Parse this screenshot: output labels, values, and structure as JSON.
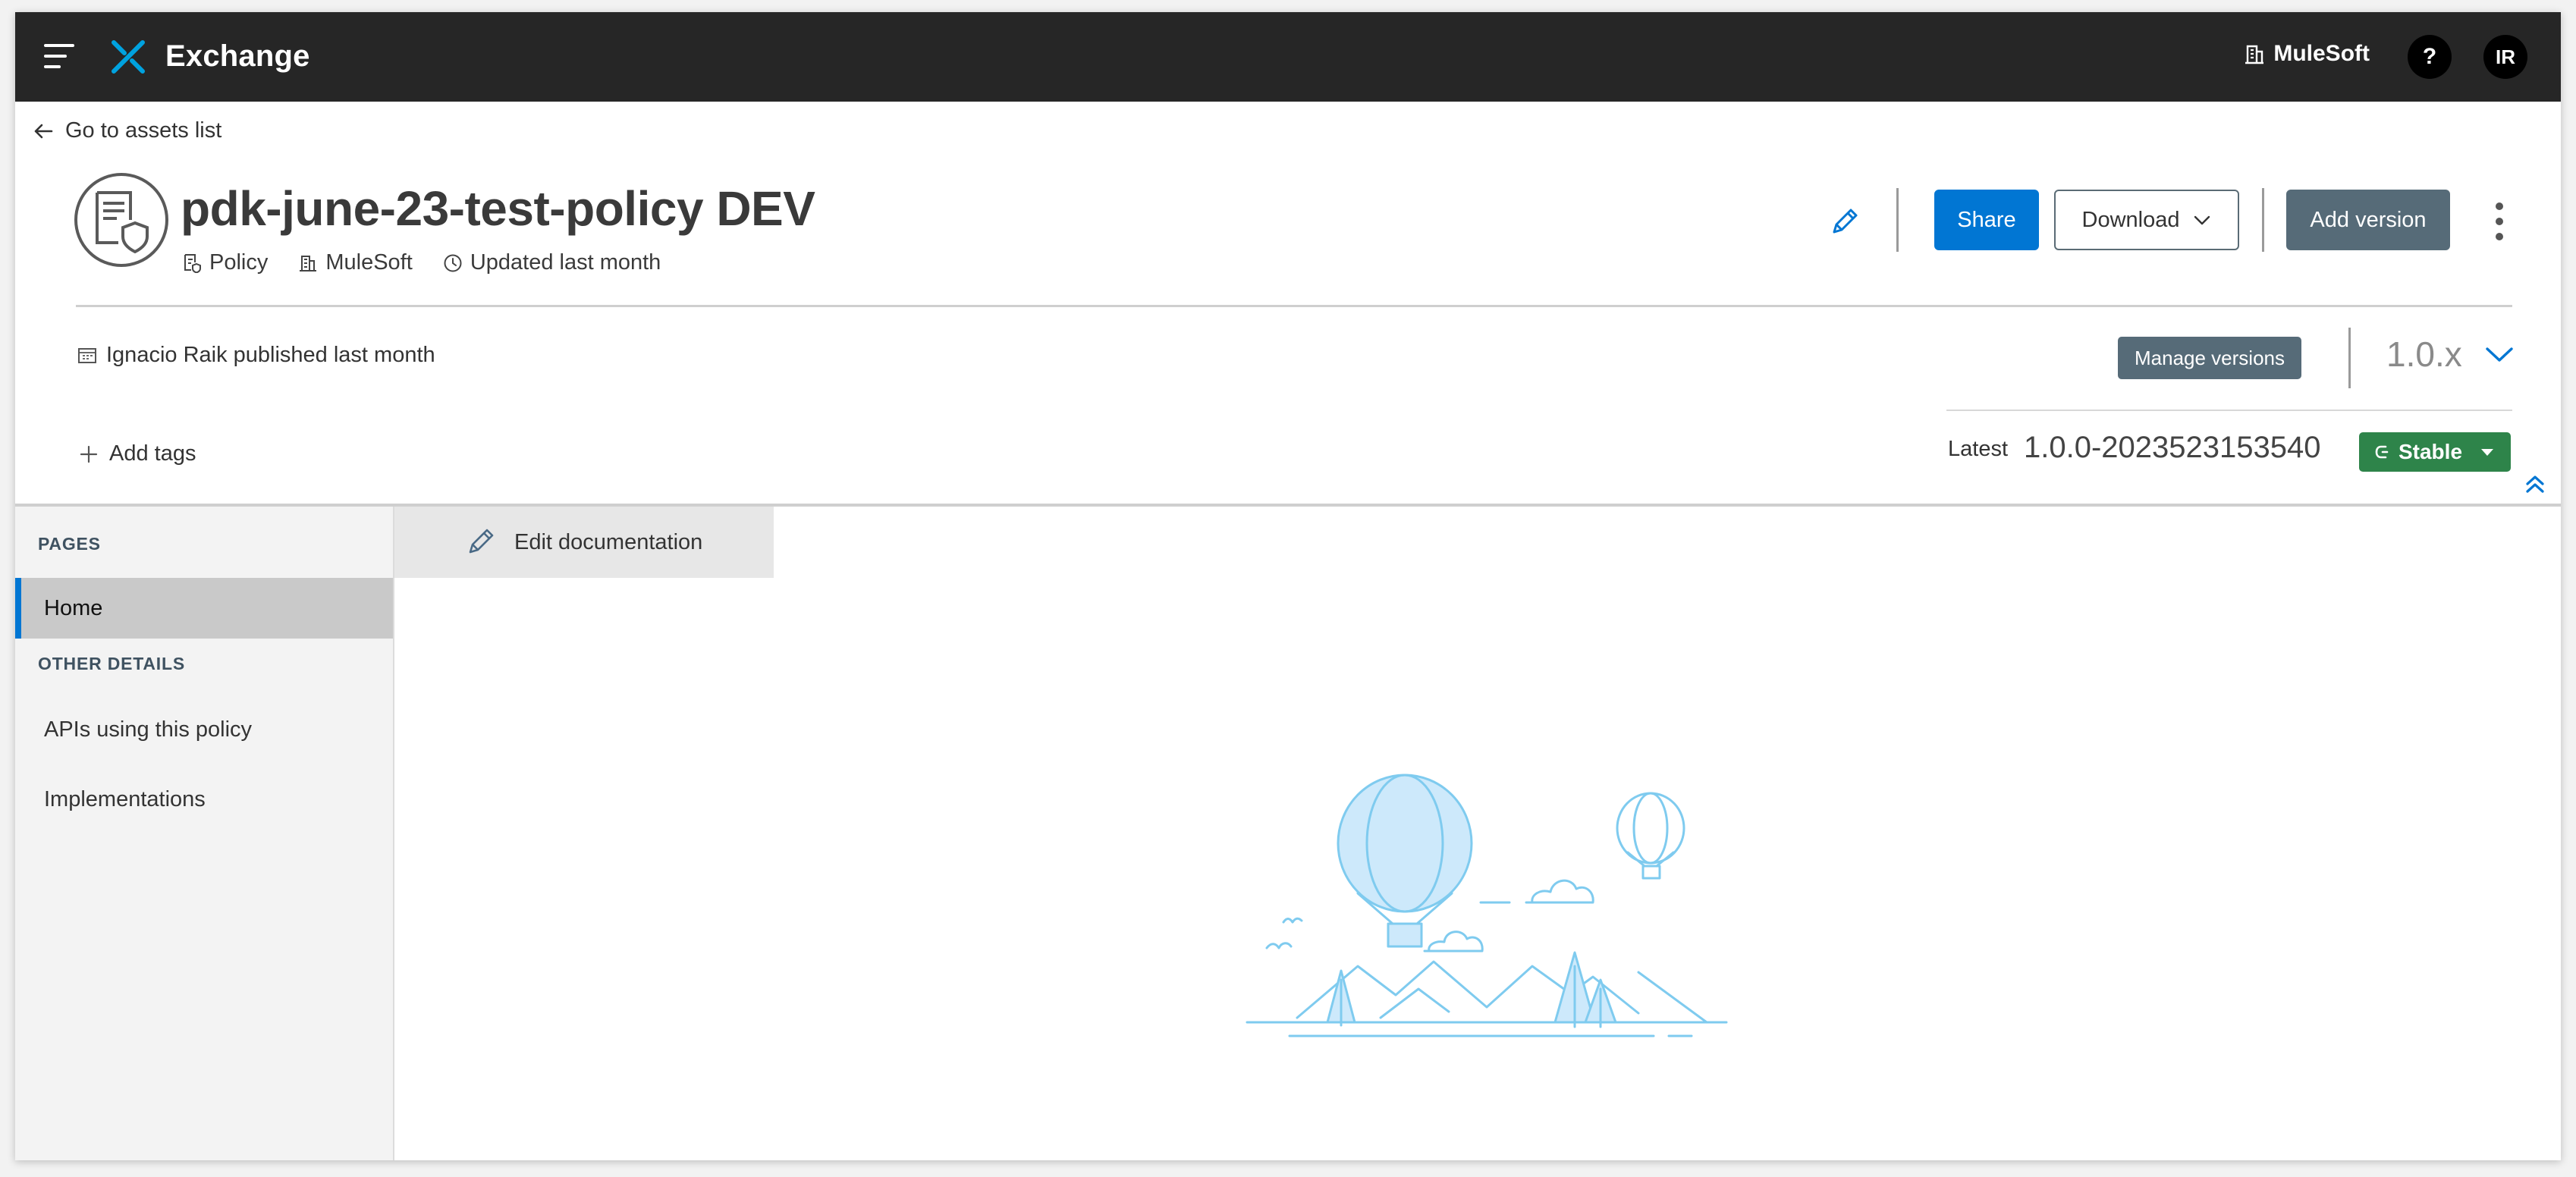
{
  "topbar": {
    "app_title": "Exchange",
    "org_name": "MuleSoft",
    "help_label": "?",
    "user_initials": "IR",
    "background_color": "#262626",
    "logo_color": "#00a2df"
  },
  "header": {
    "back_link": "Go to assets list",
    "asset_title": "pdk-june-23-test-policy DEV",
    "asset_type": "Policy",
    "asset_org": "MuleSoft",
    "updated": "Updated last month",
    "publisher": "Ignacio Raik published last month",
    "actions": {
      "share": "Share",
      "download": "Download",
      "add_version": "Add version"
    },
    "manage_versions": "Manage versions",
    "version_selected": "1.0.x",
    "add_tags": "Add tags",
    "latest_label": "Latest",
    "latest_version": "1.0.0-2023523153540",
    "status_badge": "Stable",
    "accent_color": "#0176d3",
    "stable_color": "#2e844a"
  },
  "sidebar": {
    "pages_heading": "PAGES",
    "pages": [
      {
        "label": "Home",
        "active": true
      }
    ],
    "other_heading": "OTHER DETAILS",
    "other_items": [
      {
        "label": "APIs using this policy"
      },
      {
        "label": "Implementations"
      }
    ]
  },
  "main": {
    "edit_documentation": "Edit documentation"
  }
}
